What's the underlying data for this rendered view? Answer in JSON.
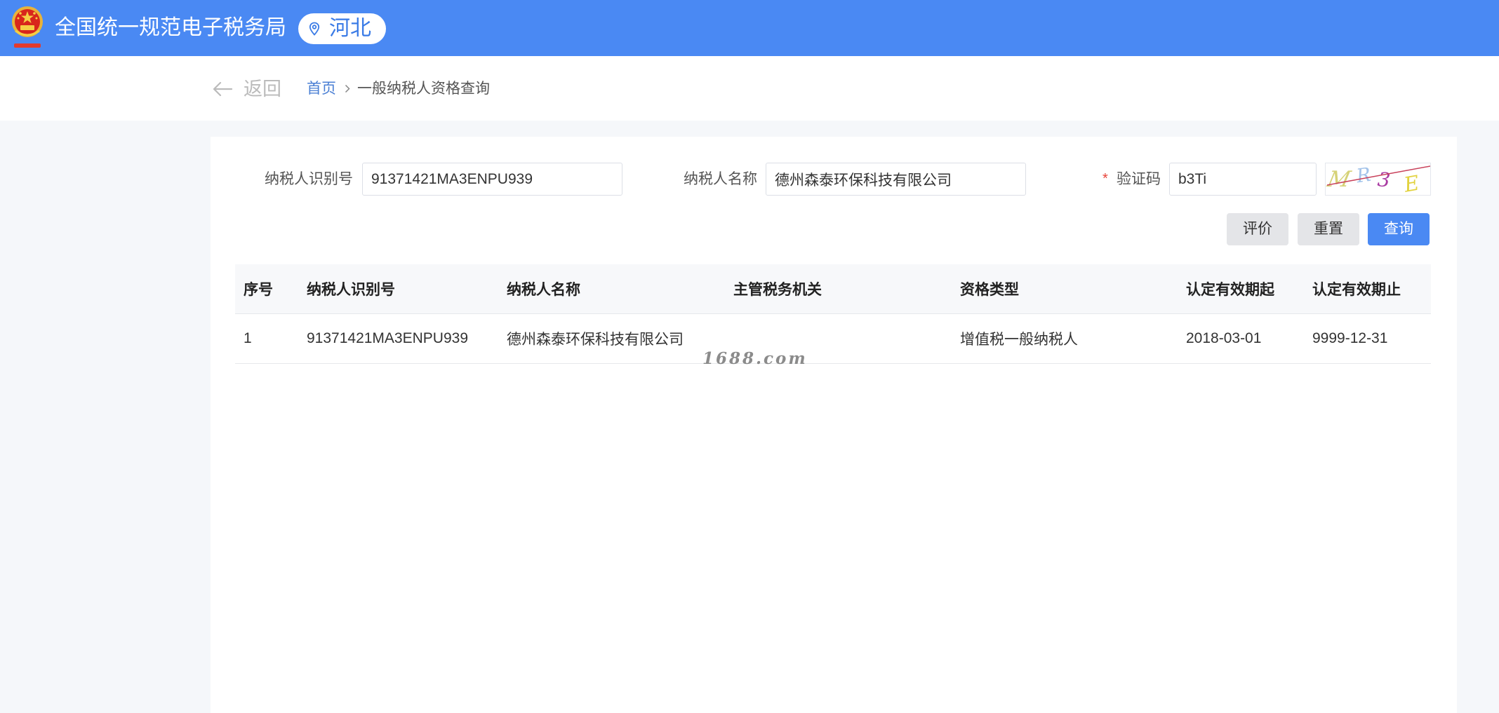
{
  "header": {
    "title": "全国统一规范电子税务局",
    "region": "河北"
  },
  "nav": {
    "back_label": "返回",
    "breadcrumb_home": "首页",
    "breadcrumb_current": "一般纳税人资格查询"
  },
  "form": {
    "taxpayer_id": {
      "label": "纳税人识别号",
      "value": "91371421MA3ENPU939"
    },
    "taxpayer_name": {
      "label": "纳税人名称",
      "value": "德州森泰环保科技有限公司"
    },
    "captcha": {
      "required_mark": "*",
      "label": "验证码",
      "value": "b3Ti",
      "image_chars": [
        "M",
        "R",
        "3",
        "E"
      ]
    }
  },
  "actions": {
    "evaluate": "评价",
    "reset": "重置",
    "query": "查询"
  },
  "table": {
    "columns": [
      "序号",
      "纳税人识别号",
      "纳税人名称",
      "主管税务机关",
      "资格类型",
      "认定有效期起",
      "认定有效期止"
    ],
    "rows": [
      [
        "1",
        "91371421MA3ENPU939",
        "德州森泰环保科技有限公司",
        "",
        "增值税一般纳税人",
        "2018-03-01",
        "9999-12-31"
      ]
    ]
  },
  "watermark": "1688.com",
  "icons": [
    "emblem-logo",
    "location-pin-icon",
    "arrow-left-icon",
    "chevron-right-icon"
  ],
  "colors": {
    "header": "#4a89f3",
    "primary": "#4a89f3",
    "link": "#4a7fd4",
    "required": "#e8443a",
    "page_bg": "#f5f7fa"
  }
}
